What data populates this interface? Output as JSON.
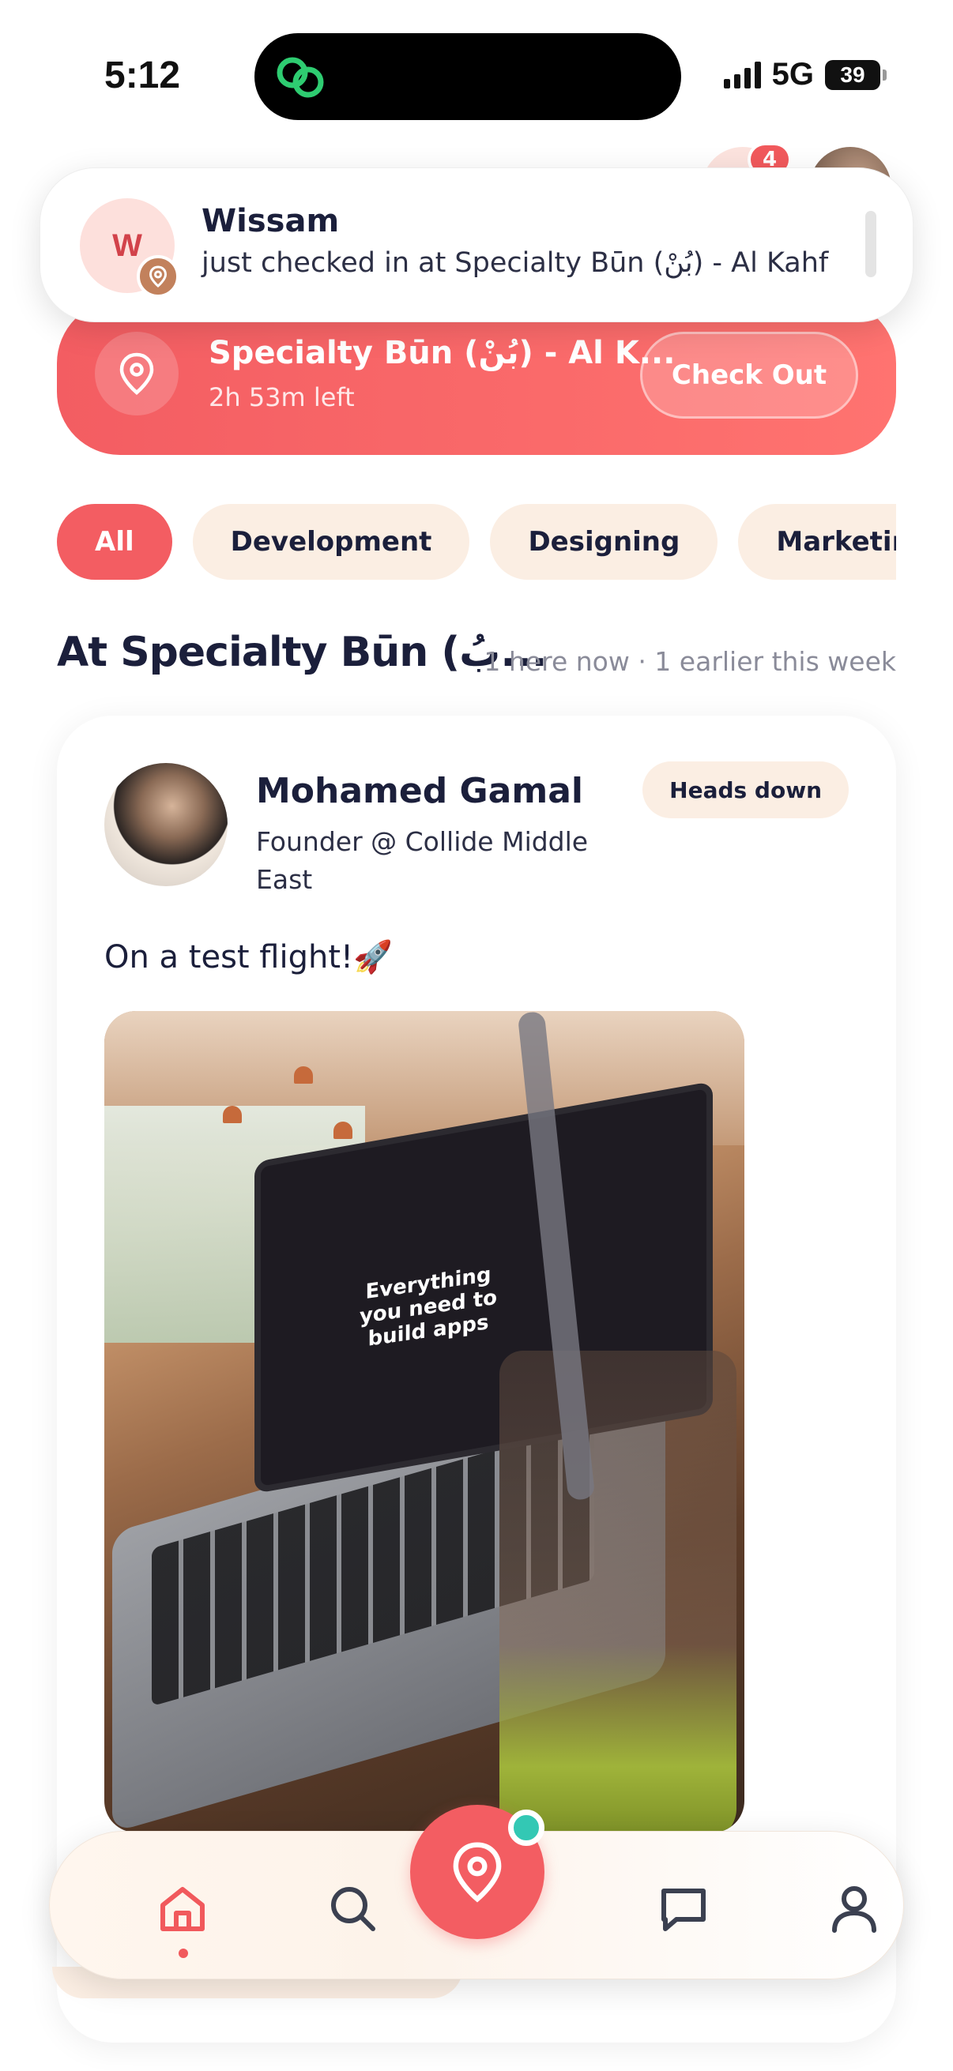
{
  "status_bar": {
    "time": "5:12",
    "network": "5G",
    "battery": "39"
  },
  "header": {
    "notifications_badge": "4"
  },
  "notification": {
    "avatar_initial": "W",
    "title": "Wissam",
    "body": "just checked in at Specialty Būn (بُنْ) - Al Kahf"
  },
  "checkin": {
    "place": "Specialty Būn (بُنْ) - Al K...",
    "time_left": "2h 53m left",
    "checkout_label": "Check Out"
  },
  "filters": {
    "chips": [
      "All",
      "Development",
      "Designing",
      "Marketing"
    ],
    "selected": "All"
  },
  "section": {
    "title": "At Specialty Būn (بُ...",
    "meta": "1 here now · 1 earlier this week"
  },
  "post": {
    "name": "Mohamed Gamal",
    "role": "Founder @ Collide Middle East",
    "status": "Heads down",
    "text": "On a test flight!🚀",
    "photo_screen_text": "Everything you need to build apps"
  },
  "tabbar": {
    "tabs": [
      "home-icon",
      "search-icon",
      "location-pin-icon",
      "chat-icon",
      "profile-icon"
    ],
    "active": "home-icon"
  },
  "colors": {
    "accent": "#f35d62",
    "chip_bg": "#fbeee3",
    "online": "#33c8b4"
  }
}
